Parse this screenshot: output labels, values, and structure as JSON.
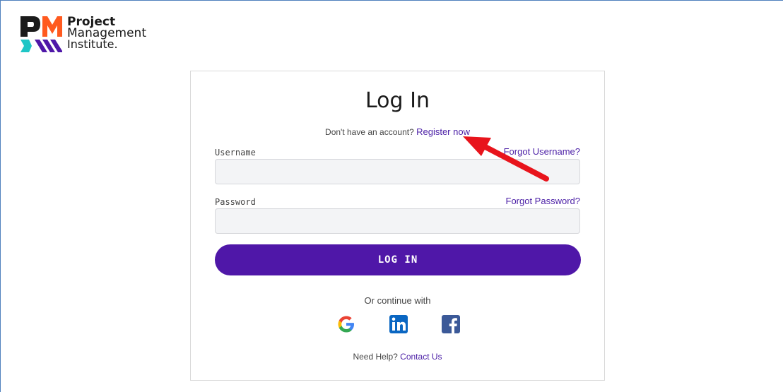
{
  "brand": {
    "line1": "Project",
    "line2": "Management",
    "line3": "Institute."
  },
  "login": {
    "title": "Log In",
    "register_prompt": "Don't have an account?",
    "register_link": "Register now",
    "username_label": "Username",
    "forgot_username": "Forgot Username?",
    "username_value": "",
    "password_label": "Password",
    "forgot_password": "Forgot Password?",
    "password_value": "",
    "login_button": "LOG IN",
    "continue_with": "Or continue with",
    "social": [
      "google-icon",
      "linkedin-icon",
      "facebook-icon"
    ],
    "help_prompt": "Need Help?",
    "contact_link": "Contact Us"
  },
  "colors": {
    "accent": "#4f17a8",
    "link": "#4b1fa6",
    "annotation_arrow": "#e8141c"
  }
}
